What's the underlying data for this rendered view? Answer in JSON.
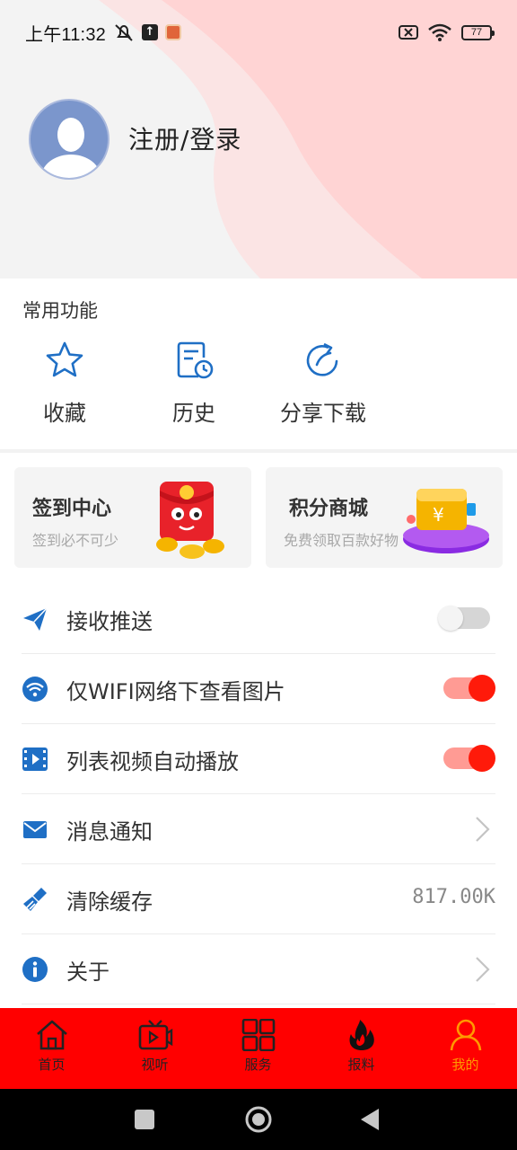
{
  "status_bar": {
    "time": "上午11:32",
    "battery": "77"
  },
  "profile": {
    "login_text": "注册/登录"
  },
  "common_functions": {
    "title": "常用功能",
    "items": [
      {
        "label": "收藏",
        "icon": "star-icon"
      },
      {
        "label": "历史",
        "icon": "history-icon"
      },
      {
        "label": "分享下载",
        "icon": "share-icon"
      }
    ]
  },
  "cards": [
    {
      "title": "签到中心",
      "subtitle": "签到必不可少",
      "icon": "red-envelope-icon"
    },
    {
      "title": "积分商城",
      "subtitle": "免费领取百款好物",
      "icon": "wallet-icon"
    }
  ],
  "settings": [
    {
      "label": "接收推送",
      "icon": "paper-plane-icon",
      "control": "toggle",
      "state": "off"
    },
    {
      "label": "仅WIFI网络下查看图片",
      "icon": "wifi-icon",
      "control": "toggle",
      "state": "on"
    },
    {
      "label": "列表视频自动播放",
      "icon": "video-icon",
      "control": "toggle",
      "state": "on"
    },
    {
      "label": "消息通知",
      "icon": "mail-icon",
      "control": "chevron"
    },
    {
      "label": "清除缓存",
      "icon": "broom-icon",
      "control": "value",
      "value": "817.00K"
    },
    {
      "label": "关于",
      "icon": "info-icon",
      "control": "chevron"
    }
  ],
  "tabbar": {
    "items": [
      {
        "label": "首页",
        "icon": "home-icon"
      },
      {
        "label": "视听",
        "icon": "tv-icon"
      },
      {
        "label": "服务",
        "icon": "grid-icon"
      },
      {
        "label": "报料",
        "icon": "flame-icon"
      },
      {
        "label": "我的",
        "icon": "user-icon",
        "active": true
      }
    ]
  },
  "colors": {
    "accent_blue": "#1f6fc5",
    "tabbar_red": "#ff0000",
    "toggle_on": "#ff1a0a",
    "active_tab": "#ff9900"
  }
}
